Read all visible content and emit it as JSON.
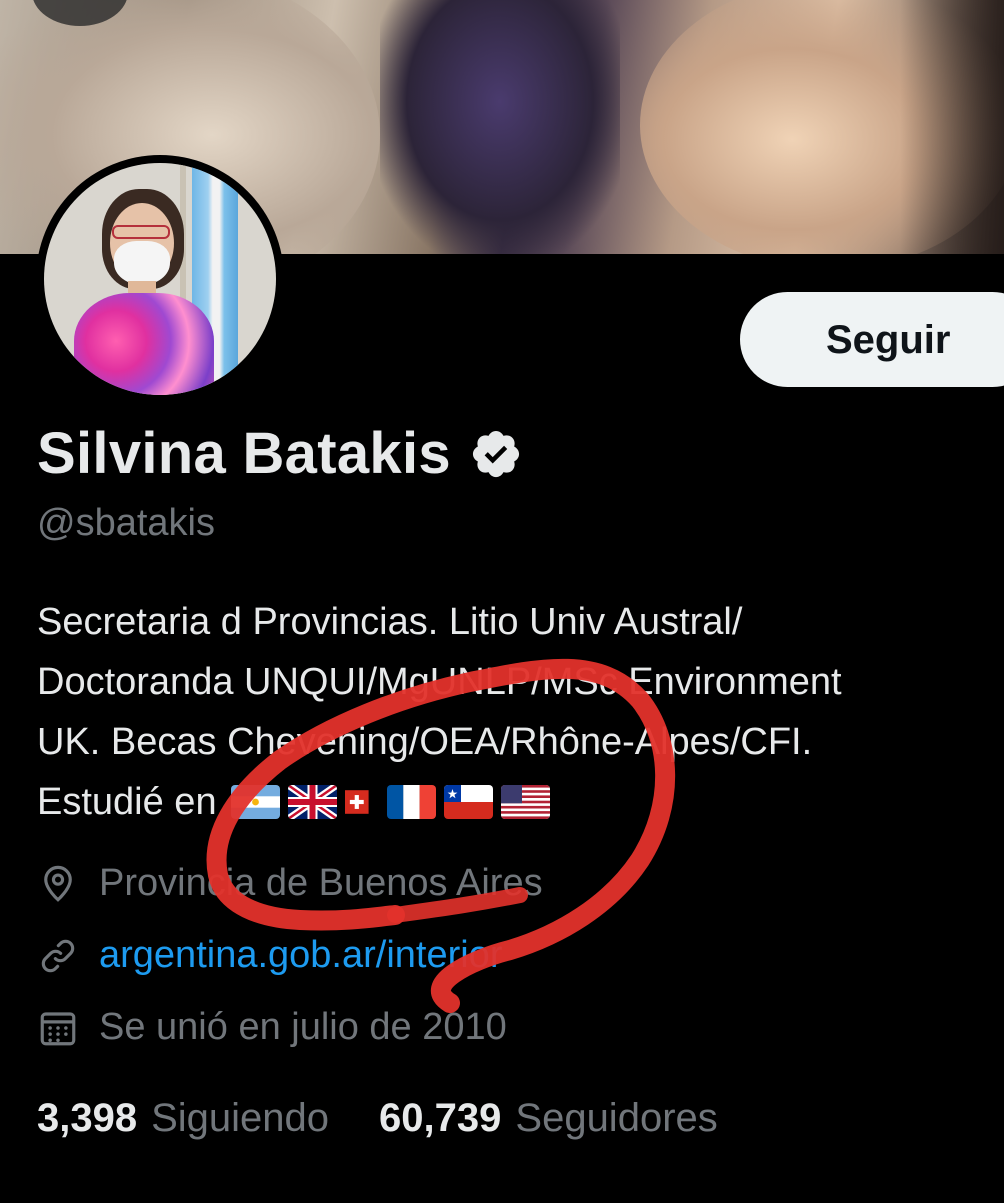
{
  "profile": {
    "name": "Silvina Batakis",
    "handle": "@sbatakis",
    "follow_label": "Seguir",
    "bio": {
      "line1": "Secretaria d Provincias. Litio Univ Austral/",
      "line2": "Doctoranda UNQUI/MgUNLP/MSc Environment",
      "line3": "UK. Becas Chevening/OEA/Rhône-Alpes/CFI.",
      "line4": "Estudié en",
      "flags": [
        "argentina-flag",
        "united-kingdom-flag",
        "switzerland-flag",
        "france-flag",
        "chile-flag",
        "usa-flag"
      ]
    },
    "location": "Provincia de Buenos Aires",
    "website": "argentina.gob.ar/interior",
    "joined": "Se unió en julio de 2010",
    "following_count": "3,398",
    "following_label": "Siguiendo",
    "followers_count": "60,739",
    "followers_label": "Seguidores"
  },
  "colors": {
    "background": "#000000",
    "primary_text": "#e7e9ea",
    "secondary_text": "#71767b",
    "link": "#1d9bf0",
    "annotation_circle": "#e3322b"
  },
  "icons": {
    "location": "location-pin-icon",
    "link": "link-icon",
    "joined": "calendar-icon",
    "verified": "verified-badge-icon"
  }
}
